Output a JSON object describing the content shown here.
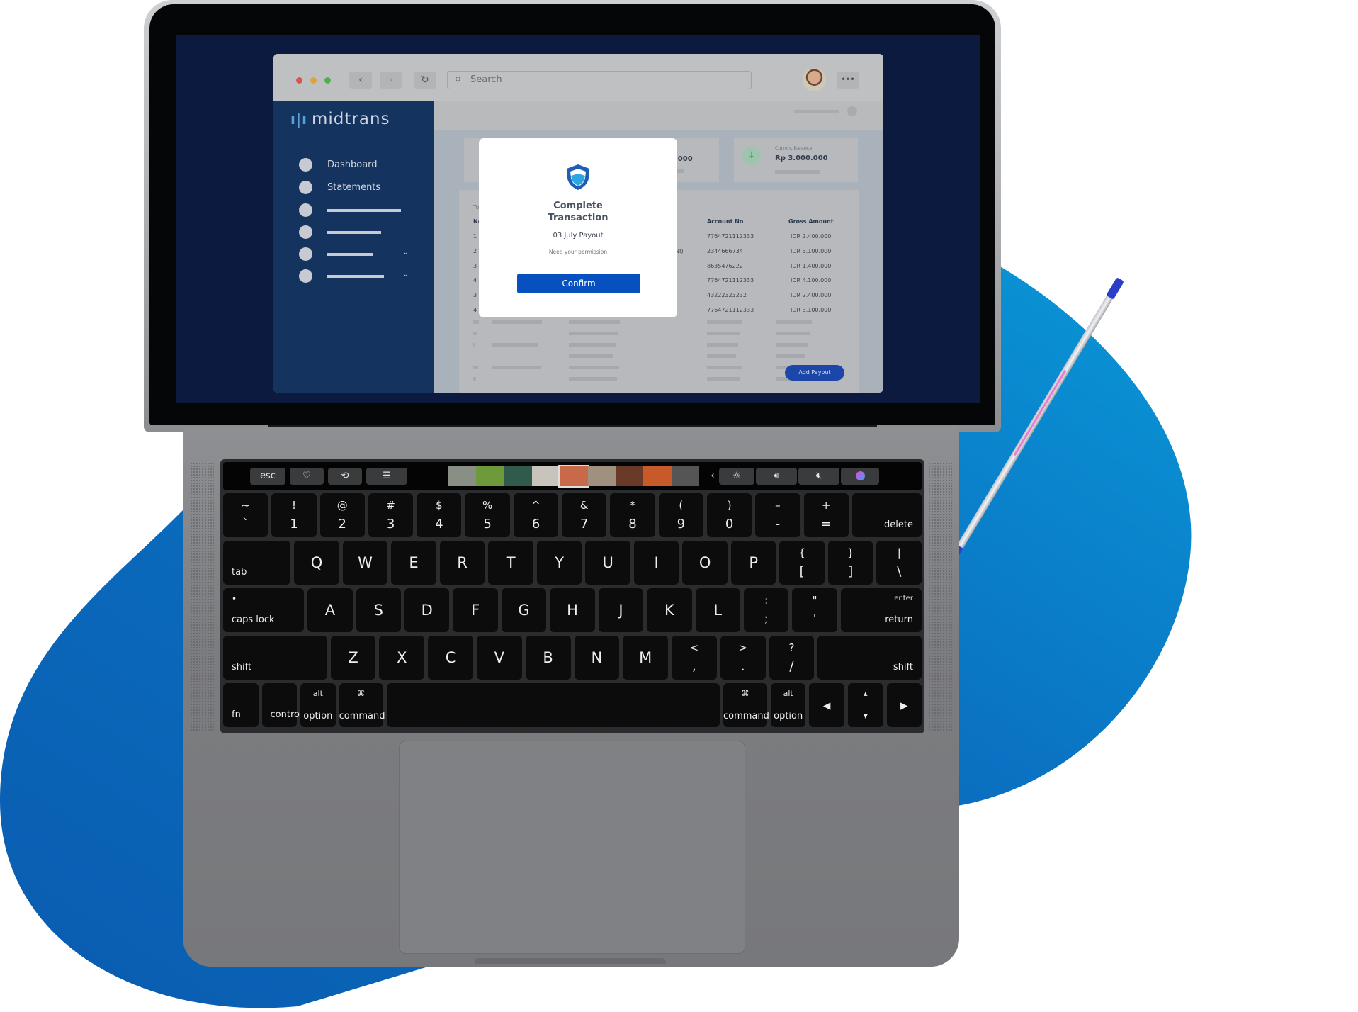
{
  "colors": {
    "blob_dark": "#0a5cb0",
    "blob_light": "#0a98d8",
    "brand_blue": "#0650c0",
    "sidebar": "#15335f"
  },
  "browser": {
    "search_placeholder": "Search",
    "back_icon": "chevron-left-icon",
    "forward_icon": "chevron-right-icon",
    "reload_icon": "reload-icon",
    "more_label": "•••"
  },
  "app": {
    "logo": "midtrans",
    "sidebar": {
      "items": [
        {
          "label": "Dashboard"
        },
        {
          "label": "Statements"
        }
      ]
    },
    "cards": {
      "partial_amount": ".000",
      "current_balance_label": "Current Balance",
      "current_balance_value": "Rp 3.000.000"
    },
    "table": {
      "title_partial": "To",
      "headers": {
        "no": "No",
        "account_no": "Account No",
        "gross_amount": "Gross Amount"
      },
      "rows": [
        {
          "no": "1",
          "bank": "",
          "account_no": "7764721112333",
          "gross_amount": "IDR 2.400.000"
        },
        {
          "no": "2",
          "bank": "NI)",
          "account_no": "2344666734",
          "gross_amount": "IDR 3.100.000"
        },
        {
          "no": "3",
          "bank": "",
          "account_no": "8635476222",
          "gross_amount": "IDR 1.400.000"
        },
        {
          "no": "4",
          "bank": "",
          "account_no": "7764721112333",
          "gross_amount": "IDR 4.100.000"
        },
        {
          "no": "3",
          "bank": "",
          "account_no": "43222323232",
          "gross_amount": "IDR 2.400.000"
        },
        {
          "no": "4",
          "bank": "",
          "account_no": "7764721112333",
          "gross_amount": "IDR 3.100.000"
        }
      ]
    },
    "add_payout": "Add Payout",
    "modal": {
      "title": "Complete\nTransaction",
      "subtitle": "03 July Payout",
      "message": "Need your permission",
      "confirm": "Confirm"
    }
  },
  "touchbar": {
    "esc": "esc",
    "icons": [
      "heart-icon",
      "rotate-icon",
      "sliders-icon",
      "chevron-left-icon",
      "brightness-icon",
      "volume-icon",
      "mute-icon",
      "siri-icon"
    ]
  },
  "keyboard": {
    "rows": [
      [
        [
          "~",
          "`"
        ],
        [
          "!",
          "1"
        ],
        [
          "@",
          "2"
        ],
        [
          "#",
          "3"
        ],
        [
          "$",
          "4"
        ],
        [
          "%",
          "5"
        ],
        [
          "^",
          "6"
        ],
        [
          "&",
          "7"
        ],
        [
          "*",
          "8"
        ],
        [
          "(",
          "9"
        ],
        [
          ")",
          "0"
        ],
        [
          "–",
          "-"
        ],
        [
          "+",
          "="
        ],
        [
          "",
          "delete"
        ]
      ],
      [
        [
          "",
          "tab"
        ],
        [
          "",
          "Q"
        ],
        [
          "",
          "W"
        ],
        [
          "",
          "E"
        ],
        [
          "",
          "R"
        ],
        [
          "",
          "T"
        ],
        [
          "",
          "Y"
        ],
        [
          "",
          "U"
        ],
        [
          "",
          "I"
        ],
        [
          "",
          "O"
        ],
        [
          "",
          "P"
        ],
        [
          "{",
          "["
        ],
        [
          "}",
          "]"
        ],
        [
          "|",
          "\\"
        ]
      ],
      [
        [
          "•",
          "caps lock"
        ],
        [
          "",
          "A"
        ],
        [
          "",
          "S"
        ],
        [
          "",
          "D"
        ],
        [
          "",
          "F"
        ],
        [
          "",
          "G"
        ],
        [
          "",
          "H"
        ],
        [
          "",
          "J"
        ],
        [
          "",
          "K"
        ],
        [
          "",
          "L"
        ],
        [
          ":",
          ";"
        ],
        [
          "\"",
          "'"
        ],
        [
          "enter",
          "return"
        ]
      ],
      [
        [
          "",
          "shift"
        ],
        [
          "",
          "Z"
        ],
        [
          "",
          "X"
        ],
        [
          "",
          "C"
        ],
        [
          "",
          "V"
        ],
        [
          "",
          "B"
        ],
        [
          "",
          "N"
        ],
        [
          "",
          "M"
        ],
        [
          "<",
          ","
        ],
        [
          ">",
          "."
        ],
        [
          "?",
          "/"
        ],
        [
          "",
          "shift"
        ]
      ],
      [
        [
          "",
          "fn"
        ],
        [
          "",
          "control"
        ],
        [
          "alt",
          "option"
        ],
        [
          "⌘",
          "command"
        ],
        [
          "",
          ""
        ],
        [
          "⌘",
          "command"
        ],
        [
          "alt",
          "option"
        ],
        [
          "",
          "◂"
        ],
        [
          "▴",
          "▾"
        ],
        [
          "",
          "▸"
        ]
      ]
    ]
  }
}
